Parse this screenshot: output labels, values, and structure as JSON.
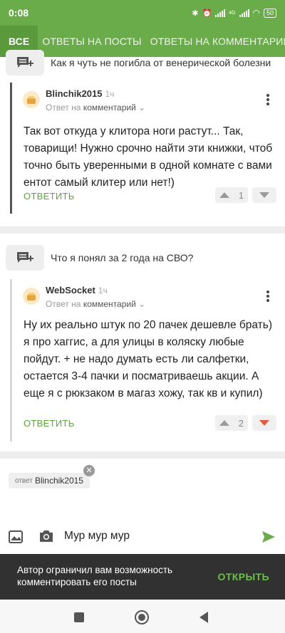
{
  "status": {
    "time": "0:08",
    "battery": "50",
    "net": "4G"
  },
  "tabs": [
    {
      "label": "ВСЕ"
    },
    {
      "label": "ОТВЕТЫ НА ПОСТЫ"
    },
    {
      "label": "ОТВЕТЫ НА КОММЕНТАРИИ"
    }
  ],
  "threads": [
    {
      "post_title": "Как я чуть не погибла от венерической болезни",
      "comment": {
        "author": "Blinchik2015",
        "time": "1ч",
        "reply_prefix": "Ответ на",
        "reply_target": "комментарий",
        "text": "Так вот откуда у клитора ноги растут... Так, товарищи! Нужно срочно найти эти книжки, чтоб точно быть уверенными в одной комнате с вами ентот самый клитер или нет!)",
        "reply_label": "ОТВЕТИТЬ",
        "rating": "1"
      }
    },
    {
      "post_title": "Что я понял за 2 года на СВО?",
      "comment": {
        "author": "WebSocket",
        "time": "1ч",
        "reply_prefix": "Ответ на",
        "reply_target": "комментарий",
        "text": "Ну их реально штук по 20 пачек дешевле брать) я про хаггис, а для улицы в коляску любые пойдут. + не надо думать есть ли салфетки, остается 3-4 пачки и посматриваешь акции. А еще я с рюкзаком в магаз хожу, так кв и купил)",
        "reply_label": "ОТВЕТИТЬ",
        "rating": "2"
      }
    }
  ],
  "reply_chip": {
    "prefix": "ответ",
    "name": "Blinchik2015"
  },
  "composer": {
    "text": "Мур мур мур"
  },
  "banner": {
    "text": "Автор ограничил вам возможность комментировать его посты",
    "button": "ОТКРЫТЬ"
  },
  "colors": {
    "accent": "#6aac4a",
    "tab_active": "#5a9a3c",
    "downvote_active": "#e65a3a",
    "banner_bg": "#313131"
  }
}
